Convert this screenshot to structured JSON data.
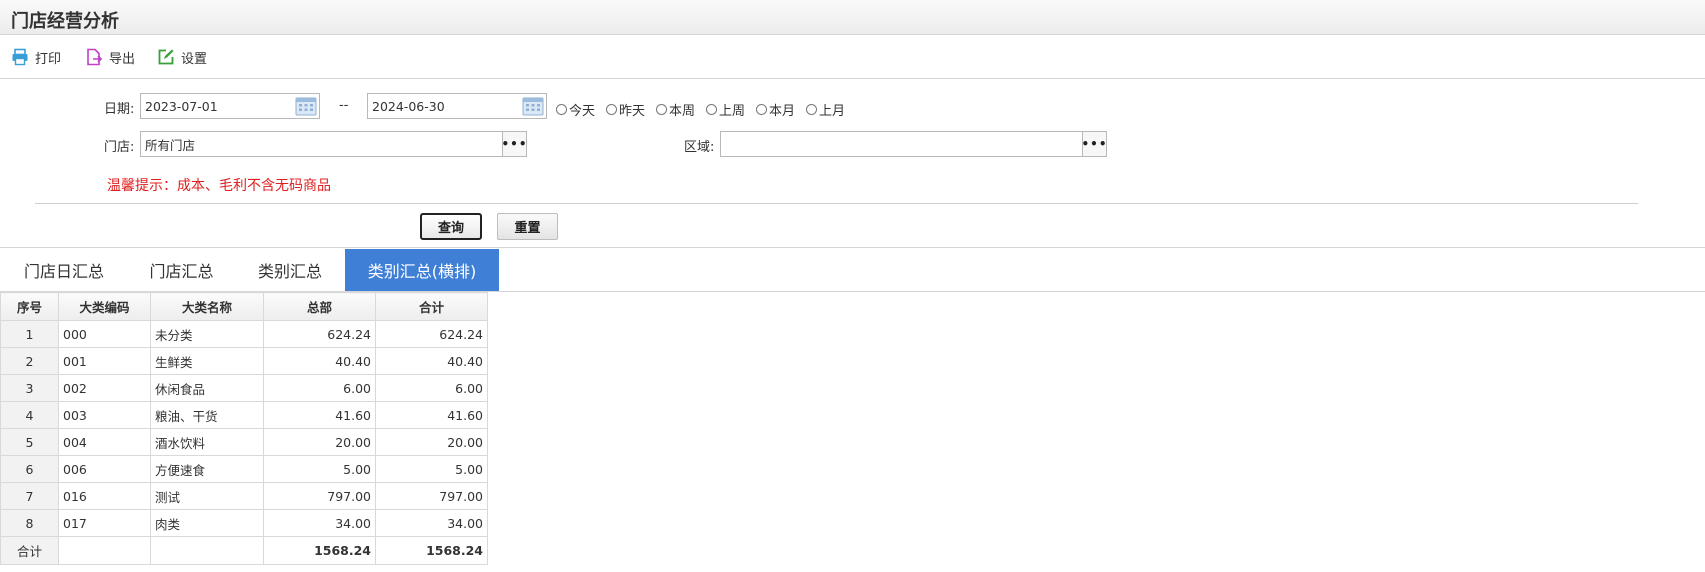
{
  "title": "门店经营分析",
  "toolbar": {
    "print": "打印",
    "export": "导出",
    "settings": "设置",
    "colors": {
      "print_icon": "#3a9ed6",
      "export_icon": "#c13fc9",
      "settings_icon": "#37a03a"
    }
  },
  "form": {
    "date_label": "日期:",
    "date_from": "2023-07-01",
    "date_sep": "--",
    "date_to": "2024-06-30",
    "quick_ranges": [
      "今天",
      "昨天",
      "本周",
      "上周",
      "本月",
      "上月"
    ],
    "store_label": "门店:",
    "store_value": "所有门店",
    "region_label": "区域:",
    "region_value": "",
    "more_button": "•••",
    "tip": "温馨提示：成本、毛利不含无码商品"
  },
  "buttons": {
    "query": "查询",
    "reset": "重置"
  },
  "tabs": [
    {
      "label": "门店日汇总",
      "active": false
    },
    {
      "label": "门店汇总",
      "active": false
    },
    {
      "label": "类别汇总",
      "active": false
    },
    {
      "label": "类别汇总(横排)",
      "active": true
    }
  ],
  "accent_color": "#3f7fd6",
  "table": {
    "columns": [
      "序号",
      "大类编码",
      "大类名称",
      "总部",
      "合计"
    ],
    "rows": [
      [
        "1",
        "000",
        "未分类",
        "624.24",
        "624.24"
      ],
      [
        "2",
        "001",
        "生鲜类",
        "40.40",
        "40.40"
      ],
      [
        "3",
        "002",
        "休闲食品",
        "6.00",
        "6.00"
      ],
      [
        "4",
        "003",
        "粮油、干货",
        "41.60",
        "41.60"
      ],
      [
        "5",
        "004",
        "酒水饮料",
        "20.00",
        "20.00"
      ],
      [
        "6",
        "006",
        "方便速食",
        "5.00",
        "5.00"
      ],
      [
        "7",
        "016",
        "测试",
        "797.00",
        "797.00"
      ],
      [
        "8",
        "017",
        "肉类",
        "34.00",
        "34.00"
      ]
    ],
    "total": [
      "合计",
      "",
      "",
      "1568.24",
      "1568.24"
    ]
  }
}
